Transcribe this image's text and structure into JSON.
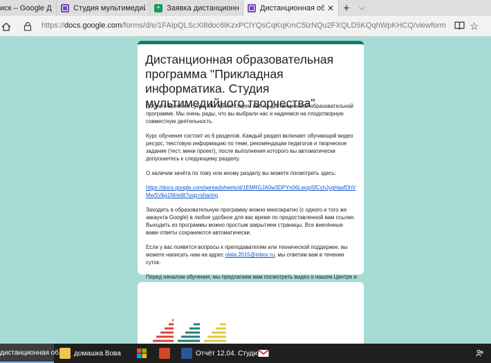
{
  "browser": {
    "tabs": [
      {
        "label": "иск – Google Диск",
        "icon": "google-drive-icon"
      },
      {
        "label": "Студия мультимедийного т",
        "icon": "google-forms-icon"
      },
      {
        "label": "Заявка дистанционная роб",
        "icon": "google-sheets-icon"
      },
      {
        "label": "Дистанционная образо",
        "icon": "google-forms-icon",
        "active": true
      }
    ],
    "new_tab": "+",
    "tab_menu": "⌵",
    "address": {
      "prefix": "https://",
      "host": "docs.google.com",
      "path": "/forms/d/e/1FAIpQLScXl8doc6lKzxPClYQsCqKqKmC5lzNQu2FXQLD5KQqhWpKHCQ/viewform"
    },
    "accent_colors": {
      "tab_active": "#f2f2f2",
      "tabbar": "#dedede"
    }
  },
  "form": {
    "header_color": "#0f7b6c",
    "background": "#a7dcd6",
    "title": "Дистанционная образовательная программа \"Прикладная информатика. Студия мультимедийного творчества\"",
    "paragraphs": [
      "Доброго времени суток! Мы приветствуем вас на дистанционной образовательной программе. Мы очень рады, что вы выбрали нас и надеемся на плодотворную совместную деятельность.",
      "Курс обучения состоит из 6 разделов. Каждый раздел включает обучающий  видео ресурс, текстовую информацию по теме, рекомендации педагогов и творческое задание (тест, мини проект), после выполнения которого вы автоматически допускаетесь к следующему разделу.",
      "О наличии зачёта по тому или иному разделу вы можете посмотреть здесь:"
    ],
    "link": "https://docs.google.com/spreadsheets/d/1EMRGJA0w3DPYn06LwupSfCchJygHasfDhVMwSVkp1Nl/edit?usp=sharing",
    "paragraph_after_link": "Заходить в образовательную программу можно многократно (с одного и того же аккаунта Google) в любое удобное для вас время по предоставленной вам ссылке. Выходить из программы можно простым закрытием страницы. Все внесённые вами ответы сохраняются автоматически.",
    "contact_before": "Если у вас появятся вопросы к преподавателям или технической поддержке, вы можете написать нам на адрес ",
    "contact_email": "olala.2015@inbox.ru",
    "contact_after": ", мы ответим вам в течении суток.",
    "closing": "Перед началом обучения, мы предлагаем вам посмотреть видео о нашем Центре и ответить на несколько организационных вопросов."
  },
  "taskbar": {
    "items": [
      {
        "label": "дистанционная об...",
        "icon": "edge-browser-icon"
      },
      {
        "label": "домашка Вова",
        "icon": "folder-icon"
      },
      {
        "label": "",
        "icon": "store-icon"
      },
      {
        "label": "",
        "icon": "powerpoint-icon"
      },
      {
        "label": "Отчёт 12.04. Студи...",
        "icon": "word-icon"
      },
      {
        "label": "",
        "icon": "mail-icon"
      }
    ]
  }
}
